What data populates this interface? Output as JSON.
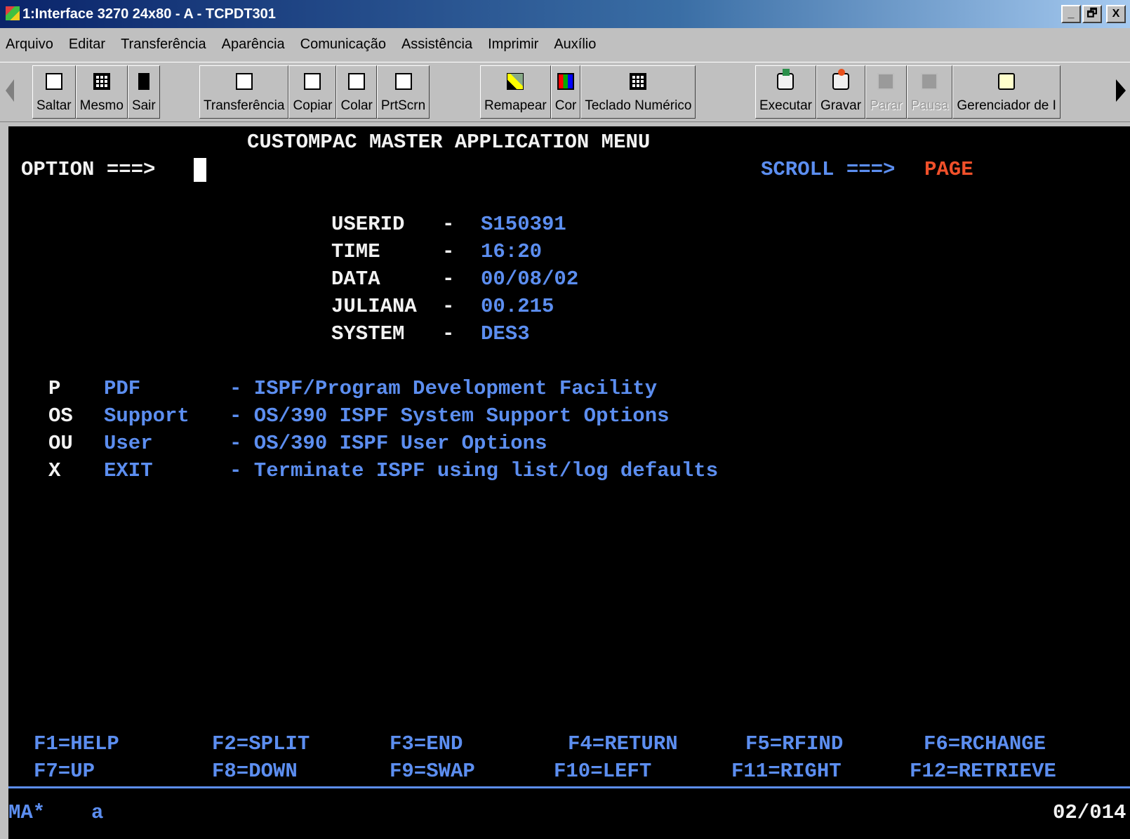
{
  "window": {
    "title": "1:Interface 3270 24x80 - A - TCPDT301",
    "controls": [
      "_",
      "🗗",
      "X"
    ]
  },
  "menu": [
    "Arquivo",
    "Editar",
    "Transferência",
    "Aparência",
    "Comunicação",
    "Assistência",
    "Imprimir",
    "Auxílio"
  ],
  "toolbar": {
    "group1": [
      {
        "label": "Saltar",
        "icon": "screen-icon"
      },
      {
        "label": "Mesmo",
        "icon": "sessions-icon"
      },
      {
        "label": "Sair",
        "icon": "exit-door-icon"
      }
    ],
    "group2": [
      {
        "label": "Transferência",
        "icon": "transfer-icon"
      },
      {
        "label": "Copiar",
        "icon": "copy-icon"
      },
      {
        "label": "Colar",
        "icon": "paste-icon"
      },
      {
        "label": "PrtScrn",
        "icon": "print-screen-icon"
      }
    ],
    "group3": [
      {
        "label": "Remapear",
        "icon": "keyboard-remap-icon"
      },
      {
        "label": "Cor",
        "icon": "color-palette-icon"
      },
      {
        "label": "Teclado Numérico",
        "icon": "numeric-keypad-icon"
      }
    ],
    "group4": [
      {
        "label": "Executar",
        "icon": "run-macro-icon",
        "enabled": true
      },
      {
        "label": "Gravar",
        "icon": "record-macro-icon",
        "enabled": true
      },
      {
        "label": "Parar",
        "icon": "stop-icon",
        "enabled": false
      },
      {
        "label": "Pausa",
        "icon": "pause-icon",
        "enabled": false
      },
      {
        "label": "Gerenciador de I",
        "icon": "manager-icon",
        "enabled": true
      }
    ]
  },
  "terminal": {
    "header": "CUSTOMPAC MASTER APPLICATION MENU",
    "option_prompt": "OPTION ===>",
    "scroll_prompt": "SCROLL ===>",
    "scroll_value": "PAGE",
    "info": [
      {
        "label": "USERID",
        "sep": "-",
        "value": "S150391"
      },
      {
        "label": "TIME",
        "sep": "-",
        "value": "16:20"
      },
      {
        "label": "DATA",
        "sep": "-",
        "value": "00/08/02"
      },
      {
        "label": "JULIANA",
        "sep": "-",
        "value": "00.215"
      },
      {
        "label": "SYSTEM",
        "sep": "-",
        "value": "DES3"
      }
    ],
    "options": [
      {
        "key": "P",
        "name": "PDF",
        "desc": "- ISPF/Program Development Facility"
      },
      {
        "key": "OS",
        "name": "Support",
        "desc": "- OS/390 ISPF System Support Options"
      },
      {
        "key": "OU",
        "name": "User",
        "desc": "- OS/390 ISPF User Options"
      },
      {
        "key": "X",
        "name": "EXIT",
        "desc": "- Terminate ISPF using list/log defaults"
      }
    ],
    "pf_keys_row1": [
      "F1=HELP",
      "F2=SPLIT",
      "F3=END",
      "F4=RETURN",
      "F5=RFIND",
      "F6=RCHANGE"
    ],
    "pf_keys_row2": [
      "F7=UP",
      "F8=DOWN",
      "F9=SWAP",
      "F10=LEFT",
      "F11=RIGHT",
      "F12=RETRIEVE"
    ],
    "status_left": "MA*",
    "status_session": "a",
    "status_right": "02/014"
  },
  "colors": {
    "terminal_bg": "#000000",
    "field_blue": "#5c8ef0",
    "text_white": "#f2f2f2",
    "highlight_orange": "#f0502a"
  }
}
